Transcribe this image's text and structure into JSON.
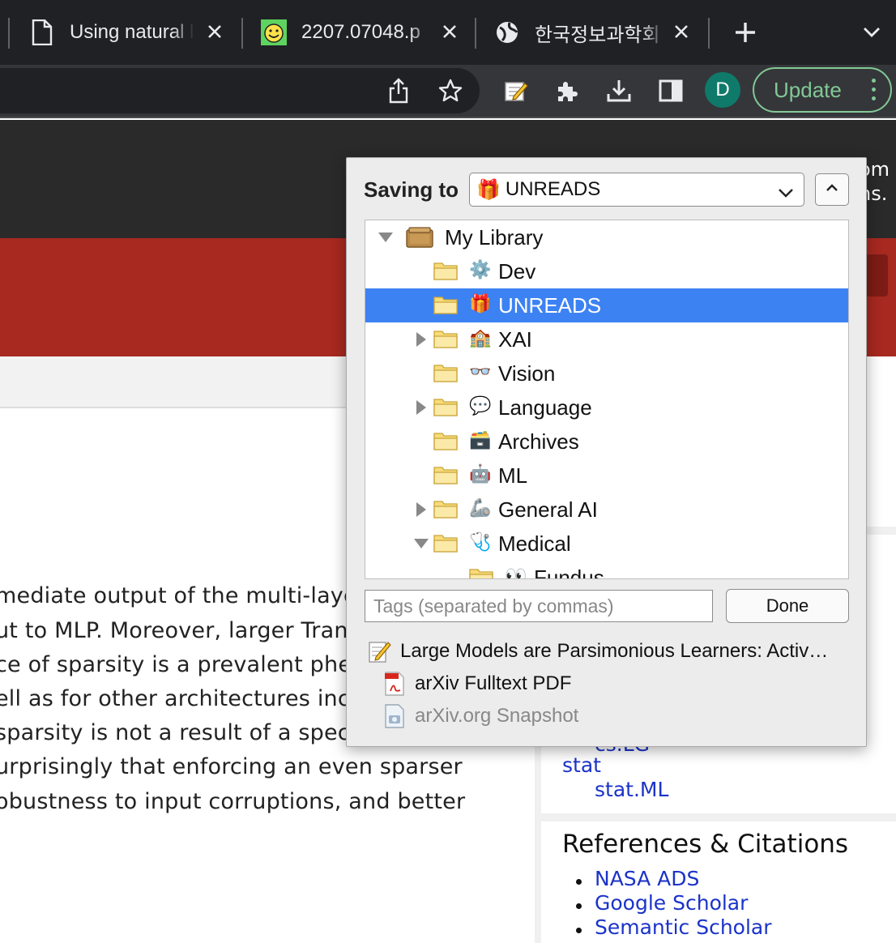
{
  "tabs": [
    {
      "title": "Using natural l",
      "favicon": "document-icon"
    },
    {
      "title": "2207.07048.p",
      "favicon": "smiley-pdf-icon"
    },
    {
      "title": "한국정보과학회 학",
      "favicon": "globe-icon"
    }
  ],
  "toolbar": {
    "profile_initial": "D",
    "update_label": "Update",
    "colors": {
      "chrome_bg": "#202124",
      "toolbar_bg": "#35363a",
      "update_green": "#81c995",
      "avatar": "#0f7a6a"
    }
  },
  "page": {
    "header_right_fragments": [
      "om",
      "ns."
    ],
    "abstract_lines": [
      "mediate output of the multi-layer",
      "ut to MLP. Moreover, larger Tran",
      "ce of sparsity is a prevalent phen",
      "ell as for other architectures inclu",
      " sparsity is not a result of a spec",
      "urprisingly that enforcing an even sparser",
      "obustness to input corruptions, and better"
    ],
    "sidebar": {
      "partial_link": "cs.LG",
      "subject_link": "stat",
      "subject_sub_link": "stat.ML",
      "refs_heading": "References & Citations",
      "refs_links": [
        "NASA ADS",
        "Google Scholar",
        "Semantic Scholar"
      ]
    },
    "colors": {
      "header_dark": "#2a2a2a",
      "arxiv_red": "#a72920",
      "link_blue": "#1b33c9"
    }
  },
  "zotero": {
    "saving_label": "Saving to",
    "selected_collection": {
      "emoji": "🎁",
      "name": "UNREADS"
    },
    "tree": [
      {
        "label": "My Library",
        "emoji": "",
        "level": 0,
        "twisty": "expanded",
        "kind": "library"
      },
      {
        "label": "Dev",
        "emoji": "⚙️",
        "level": 1,
        "twisty": "none",
        "kind": "folder"
      },
      {
        "label": "UNREADS",
        "emoji": "🎁",
        "level": 1,
        "twisty": "none",
        "kind": "folder",
        "selected": true
      },
      {
        "label": "XAI",
        "emoji": "🏫",
        "level": 1,
        "twisty": "collapsed",
        "kind": "folder"
      },
      {
        "label": "Vision",
        "emoji": "👓",
        "level": 1,
        "twisty": "none",
        "kind": "folder"
      },
      {
        "label": "Language",
        "emoji": "💬",
        "level": 1,
        "twisty": "collapsed",
        "kind": "folder"
      },
      {
        "label": "Archives",
        "emoji": "🗃️",
        "level": 1,
        "twisty": "none",
        "kind": "folder"
      },
      {
        "label": "ML",
        "emoji": "🤖",
        "level": 1,
        "twisty": "none",
        "kind": "folder"
      },
      {
        "label": "General AI",
        "emoji": "🦾",
        "level": 1,
        "twisty": "collapsed",
        "kind": "folder"
      },
      {
        "label": "Medical",
        "emoji": "🩺",
        "level": 1,
        "twisty": "expanded",
        "kind": "folder"
      },
      {
        "label": "Fundus",
        "emoji": "👀",
        "level": 2,
        "twisty": "none",
        "kind": "folder"
      }
    ],
    "tags_placeholder": "Tags (separated by commas)",
    "done_label": "Done",
    "items": [
      {
        "title": "Large Models are Parsimonious Learners: Activ…",
        "icon": "journal-article-icon",
        "dim": false
      },
      {
        "title": "arXiv Fulltext PDF",
        "icon": "pdf-icon",
        "dim": false
      },
      {
        "title": "arXiv.org Snapshot",
        "icon": "snapshot-icon",
        "dim": true
      }
    ],
    "colors": {
      "selection": "#3d82f3",
      "panel_bg": "#ececec",
      "folder_yellow": "#f5d36a"
    }
  }
}
